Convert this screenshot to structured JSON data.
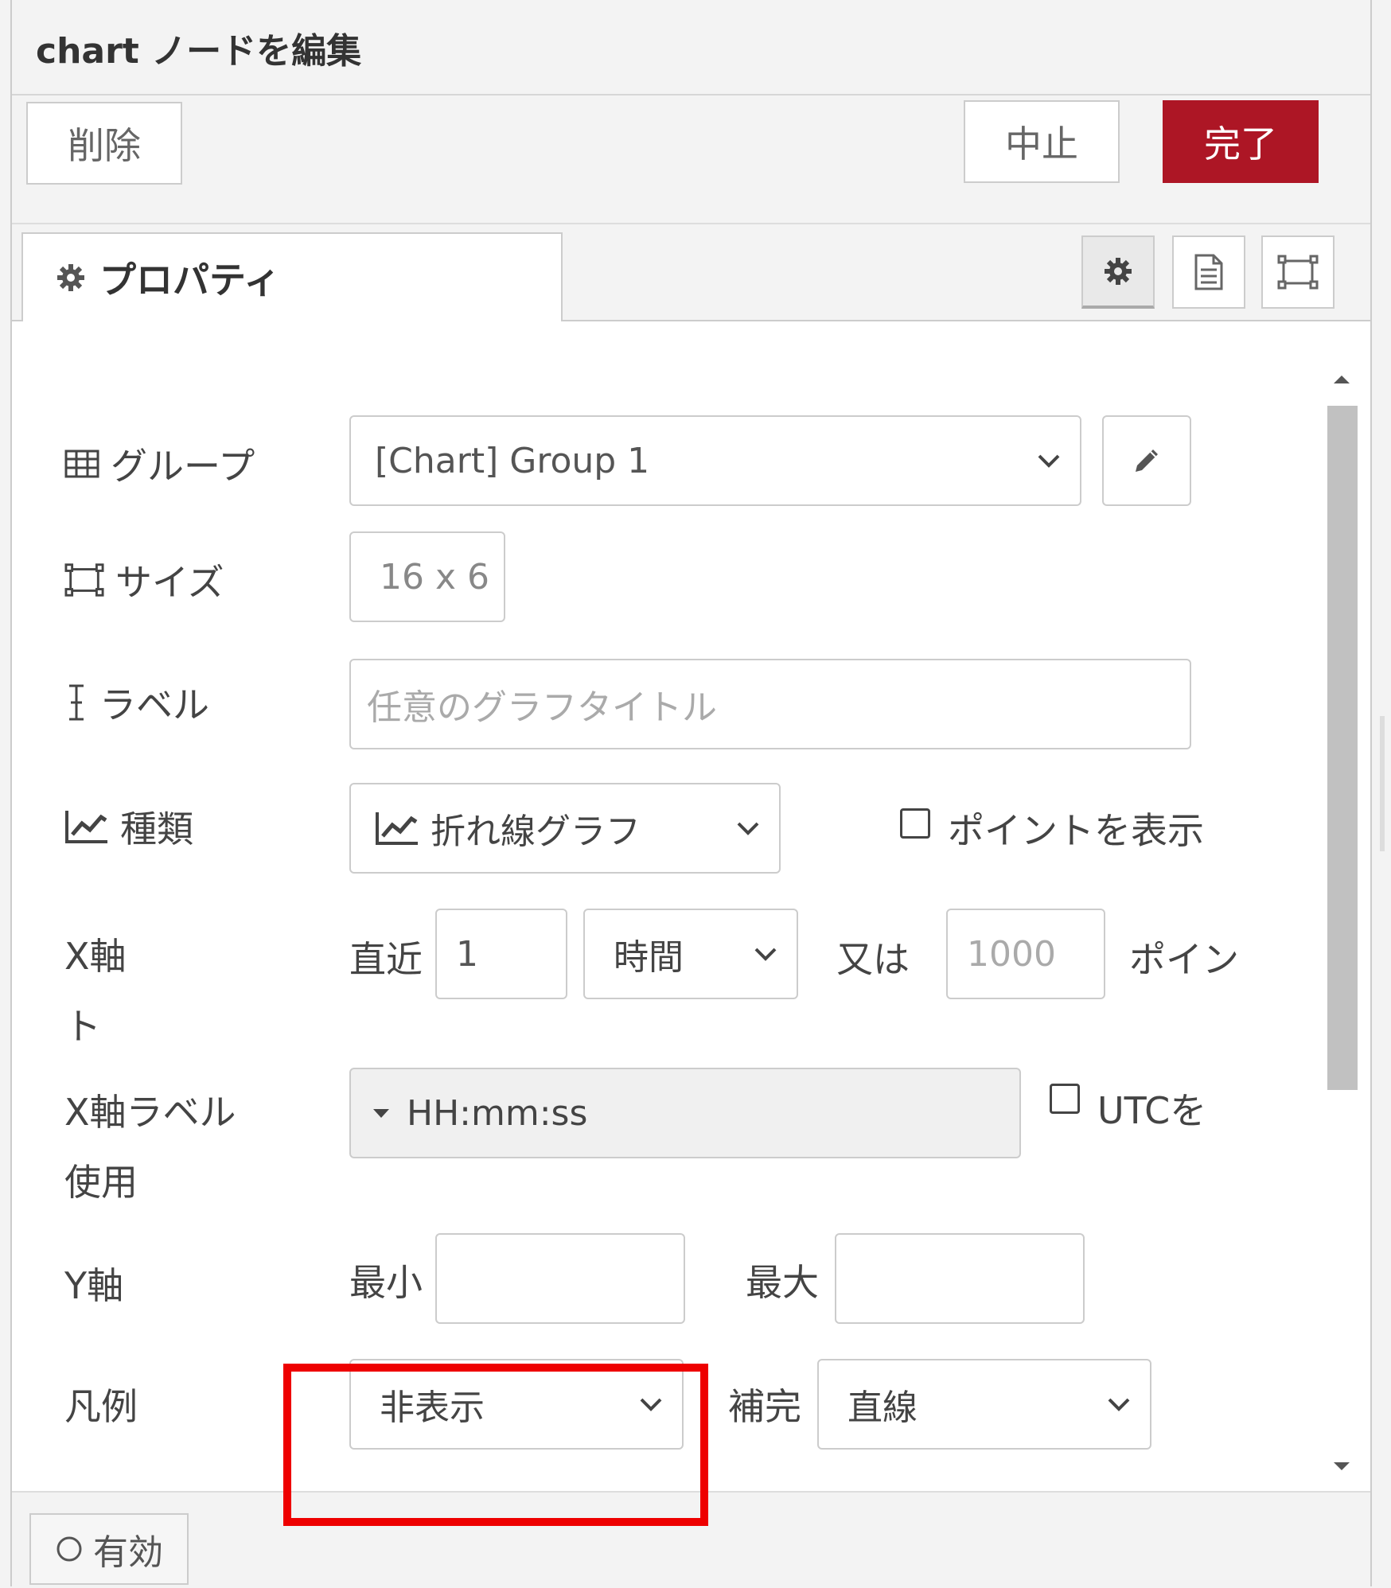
{
  "header": {
    "title": "chart ノードを編集"
  },
  "toolbar": {
    "delete_label": "削除",
    "cancel_label": "中止",
    "done_label": "完了"
  },
  "tabs": {
    "properties_label": "プロパティ",
    "icons": [
      "gear-icon",
      "document-icon",
      "size-icon"
    ]
  },
  "form": {
    "group": {
      "label": "グループ",
      "value": "[Chart] Group 1"
    },
    "size": {
      "label": "サイズ",
      "value": "16 x 6"
    },
    "label": {
      "label": "ラベル",
      "placeholder": "任意のグラフタイトル"
    },
    "type": {
      "label": "種類",
      "value": "折れ線グラフ",
      "show_points_label": "ポイントを表示"
    },
    "xaxis": {
      "label_line1": "X軸",
      "label_line2": "ト",
      "recent_label": "直近",
      "recent_value": "1",
      "unit_value": "時間",
      "or_label": "又は",
      "points_value": "1000",
      "points_label": "ポイン"
    },
    "xaxis_label": {
      "label_line1": "X軸ラベル",
      "label_line2": "使用",
      "value": "HH:mm:ss",
      "utc_label": "UTCを"
    },
    "yaxis": {
      "label": "Y軸",
      "min_label": "最小",
      "max_label": "最大"
    },
    "legend": {
      "label": "凡例",
      "value": "非表示",
      "interp_label": "補完",
      "interp_value": "直線"
    }
  },
  "footer": {
    "enable_label": "有効"
  },
  "colors": {
    "primary": "#ad1625",
    "highlight": "#ee0000"
  }
}
